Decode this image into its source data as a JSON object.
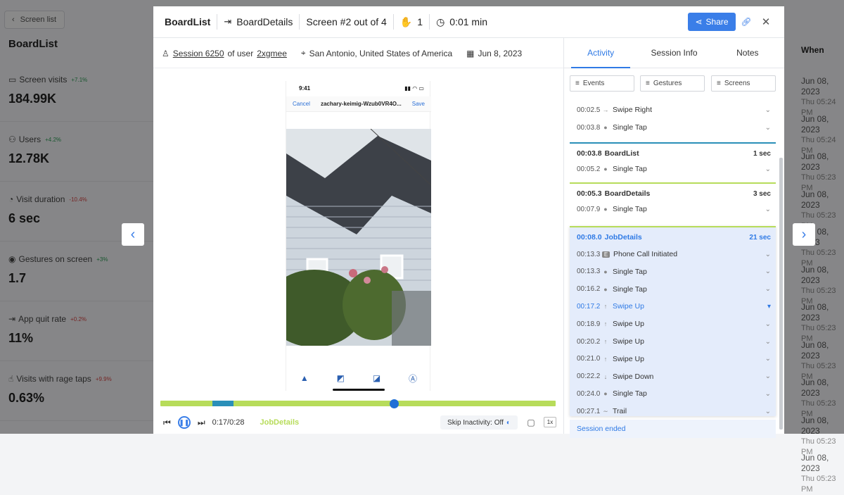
{
  "background": {
    "back_label": "Screen list",
    "title": "BoardList",
    "metrics": [
      {
        "label": "Screen visits",
        "change": "+7.1%",
        "change_color": "#2e9d57",
        "value": "184.99K",
        "icon": "screen-icon"
      },
      {
        "label": "Users",
        "change": "+4.2%",
        "change_color": "#2e9d57",
        "value": "12.78K",
        "icon": "users-icon"
      },
      {
        "label": "Visit duration",
        "change": "-10.4%",
        "change_color": "#d64545",
        "value": "6 sec",
        "icon": "clock-icon"
      },
      {
        "label": "Gestures on screen",
        "change": "+3%",
        "change_color": "#2e9d57",
        "value": "1.7",
        "icon": "gesture-icon"
      },
      {
        "label": "App quit rate",
        "change": "+0.2%",
        "change_color": "#d64545",
        "value": "11%",
        "icon": "exit-icon"
      },
      {
        "label": "Visits with rage taps",
        "change": "+9.9%",
        "change_color": "#d64545",
        "value": "0.63%",
        "icon": "tap-icon"
      }
    ],
    "when_header": "When",
    "when_rows": [
      {
        "date": "Jun 08, 2023",
        "time": "Thu 05:24 PM"
      },
      {
        "date": "Jun 08, 2023",
        "time": "Thu 05:24 PM"
      },
      {
        "date": "Jun 08, 2023",
        "time": "Thu 05:23 PM"
      },
      {
        "date": "Jun 08, 2023",
        "time": "Thu 05:23 PM"
      },
      {
        "date": "Jun 08, 2023",
        "time": "Thu 05:23 PM"
      },
      {
        "date": "Jun 08, 2023",
        "time": "Thu 05:23 PM"
      },
      {
        "date": "Jun 08, 2023",
        "time": "Thu 05:23 PM"
      },
      {
        "date": "Jun 08, 2023",
        "time": "Thu 05:23 PM"
      },
      {
        "date": "Jun 08, 2023",
        "time": "Thu 05:23 PM"
      },
      {
        "date": "Jun 08, 2023",
        "time": "Thu 05:23 PM"
      },
      {
        "date": "Jun 08, 2023",
        "time": "Thu 05:23 PM"
      }
    ]
  },
  "header": {
    "screen_name": "BoardList",
    "next_screen": "BoardDetails",
    "screen_position": "Screen #2 out of 4",
    "gestures_count": "1",
    "duration": "0:01 min",
    "share_label": "Share"
  },
  "info": {
    "session": "Session 6250",
    "of_user": "of user",
    "user": "2xgmee",
    "location": "San Antonio, United States of America",
    "date": "Jun 8, 2023"
  },
  "phone": {
    "time": "9:41",
    "cancel": "Cancel",
    "file_name": "zachary-keimig-Wzub0VR4O...",
    "save": "Save"
  },
  "player": {
    "current_time": "0:17/0:28",
    "screen_label": "JobDetails",
    "skip_label": "Skip Inactivity: Off",
    "speed": "1x",
    "progress": 0.59
  },
  "sidebar": {
    "tabs": [
      "Activity",
      "Session Info",
      "Notes"
    ],
    "filters": [
      "Events",
      "Gestures",
      "Screens"
    ],
    "top_events": [
      {
        "time": "00:02.5",
        "name": "Swipe Right",
        "icon": "→"
      },
      {
        "time": "00:03.8",
        "name": "Single Tap",
        "icon": "●"
      }
    ],
    "sections": [
      {
        "time": "00:03.8",
        "name": "BoardList",
        "duration": "1 sec",
        "accent": "#2a8fb8",
        "events": [
          {
            "time": "00:05.2",
            "name": "Single Tap",
            "icon": "●"
          }
        ]
      },
      {
        "time": "00:05.3",
        "name": "BoardDetails",
        "duration": "3 sec",
        "accent": "#b7dc5a",
        "events": [
          {
            "time": "00:07.9",
            "name": "Single Tap",
            "icon": "●"
          }
        ]
      }
    ],
    "active_section": {
      "time": "00:08.0",
      "name": "JobDetails",
      "duration": "21 sec",
      "events": [
        {
          "time": "00:13.3",
          "name": "Phone Call Initiated",
          "icon": "E"
        },
        {
          "time": "00:13.3",
          "name": "Single Tap",
          "icon": "●"
        },
        {
          "time": "00:16.2",
          "name": "Single Tap",
          "icon": "●"
        },
        {
          "time": "00:17.2",
          "name": "Swipe Up",
          "icon": "↑"
        },
        {
          "time": "00:18.9",
          "name": "Swipe Up",
          "icon": "↑"
        },
        {
          "time": "00:20.2",
          "name": "Swipe Up",
          "icon": "↑"
        },
        {
          "time": "00:21.0",
          "name": "Swipe Up",
          "icon": "↑"
        },
        {
          "time": "00:22.2",
          "name": "Swipe Down",
          "icon": "↓"
        },
        {
          "time": "00:24.0",
          "name": "Single Tap",
          "icon": "●"
        },
        {
          "time": "00:27.1",
          "name": "Trail",
          "icon": "∼"
        }
      ]
    },
    "ended_label": "Session ended"
  }
}
